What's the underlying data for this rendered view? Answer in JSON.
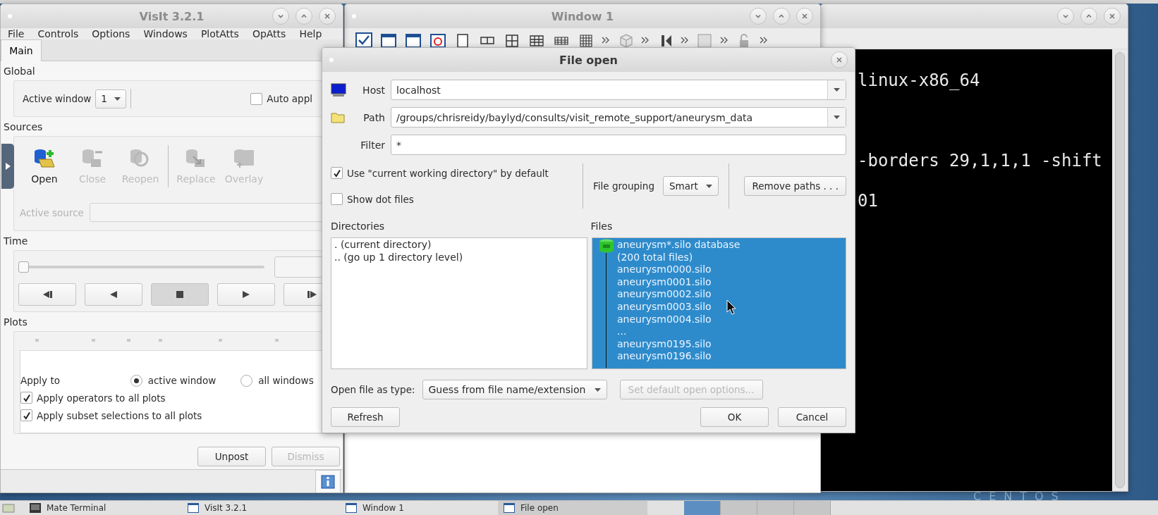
{
  "desktop": {
    "wallpaper_text": "CENTOS"
  },
  "visit_window": {
    "title": "VisIt 3.2.1",
    "menu": [
      "File",
      "Controls",
      "Options",
      "Windows",
      "PlotAtts",
      "OpAtts",
      "Help"
    ],
    "tabs": [
      {
        "label": "Main",
        "selected": true
      }
    ],
    "global": {
      "heading": "Global",
      "active_window_label": "Active window",
      "active_window_value": "1",
      "auto_apply": {
        "label": "Auto appl",
        "checked": false
      }
    },
    "sources": {
      "heading": "Sources",
      "buttons": [
        {
          "kind": "open",
          "label": "Open",
          "disabled": false
        },
        {
          "kind": "close",
          "label": "Close",
          "disabled": true
        },
        {
          "kind": "reopen",
          "label": "Reopen",
          "disabled": true
        },
        {
          "kind": "replace",
          "label": "Replace",
          "disabled": true
        },
        {
          "kind": "overlay",
          "label": "Overlay",
          "disabled": true
        }
      ],
      "active_source": {
        "label": "Active source",
        "disabled": true
      }
    },
    "time": {
      "heading": "Time",
      "level": 0,
      "controls": [
        {
          "kind": "step-back",
          "pressed": false
        },
        {
          "kind": "play-back",
          "pressed": false
        },
        {
          "kind": "stop",
          "pressed": true
        },
        {
          "kind": "play",
          "pressed": false
        },
        {
          "kind": "step-forward",
          "pressed": false
        }
      ]
    },
    "plots": {
      "heading": "Plots",
      "apply_to": {
        "label": "Apply to",
        "options": [
          {
            "label": "active window",
            "selected": true
          },
          {
            "label": "all windows",
            "selected": false
          }
        ]
      },
      "checkboxes": [
        {
          "label": "Apply operators to all plots",
          "checked": true
        },
        {
          "label": "Apply subset selections to all plots",
          "checked": true
        }
      ]
    },
    "buttons": [
      {
        "label": "Unpost",
        "disabled": false
      },
      {
        "label": "Dismiss",
        "disabled": true
      }
    ]
  },
  "window_1": {
    "title": "Window 1"
  },
  "terminal": {
    "lines": [
      "linux-x86_64",
      "-borders 29,1,1,1 -shift",
      "01"
    ]
  },
  "file_open_dialog": {
    "title": "File open",
    "host": {
      "label": "Host",
      "value": "localhost"
    },
    "path": {
      "label": "Path",
      "value": "/groups/chrisreidy/baylyd/consults/visit_remote_support/aneurysm_data"
    },
    "filter": {
      "label": "Filter",
      "value": "*"
    },
    "use_cwd": {
      "label": "Use \"current working directory\" by default",
      "checked": true
    },
    "show_dot_files": {
      "label": "Show dot files",
      "checked": false
    },
    "file_grouping": {
      "label": "File grouping",
      "value": "Smart"
    },
    "remove_paths_button": "Remove paths . . .",
    "directories": {
      "heading": "Directories",
      "items": [
        {
          "label": ". (current directory)",
          "selected": false
        },
        {
          "label": ".. (go up 1 directory level)",
          "selected": false
        }
      ]
    },
    "files": {
      "heading": "Files",
      "items": [
        {
          "name": "aneurysm*.silo database",
          "detail": "(200 total files)",
          "selected": true,
          "expanded": true,
          "children": [
            "aneurysm0000.silo",
            "aneurysm0001.silo",
            "aneurysm0002.silo",
            "aneurysm0003.silo",
            "aneurysm0004.silo",
            "...",
            "aneurysm0195.silo",
            "aneurysm0196.silo"
          ]
        }
      ]
    },
    "open_as": {
      "label": "Open file as type:",
      "value": "Guess from file name/extension"
    },
    "default_options_button": {
      "label": "Set default open options...",
      "disabled": true
    },
    "buttons": [
      "Refresh",
      "OK",
      "Cancel"
    ]
  },
  "taskbar": {
    "items": [
      {
        "kind": "terminal",
        "label": "Mate Terminal",
        "selected": false
      },
      {
        "kind": "window",
        "label": "VisIt 3.2.1",
        "selected": false
      },
      {
        "kind": "window",
        "label": "Window 1",
        "selected": false
      },
      {
        "kind": "window",
        "label": "File open",
        "selected": true
      }
    ],
    "workspaces": [
      {
        "selected": true
      },
      {
        "selected": false
      },
      {
        "selected": false
      },
      {
        "selected": false
      }
    ]
  }
}
